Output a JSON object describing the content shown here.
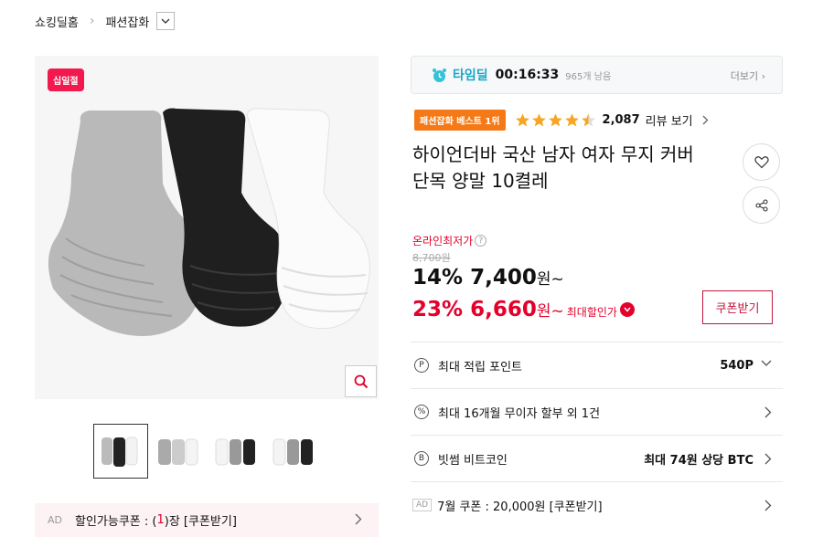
{
  "breadcrumb": {
    "home": "쇼킹딜홈",
    "category": "패션잡화"
  },
  "product_image": {
    "badge": "십일절"
  },
  "ad_coupon_bar": {
    "ad_tag": "AD",
    "label_prefix": "할인가능쿠폰 : (",
    "count": "1",
    "label_suffix": ")장 [쿠폰받기]"
  },
  "timedeal": {
    "label": "타임딜",
    "timer": "00:16:33",
    "remaining": "965개 남음",
    "more": "더보기"
  },
  "rating": {
    "best_badge": "패션잡화 베스트 1위",
    "stars": 4.5,
    "review_count": "2,087",
    "review_label": "리뷰 보기"
  },
  "title_line1": "하이언더바 국산 남자 여자 무지 커버",
  "title_line2": "단목 양말 10켤레",
  "price": {
    "lowest_label": "온라인최저가",
    "original": "8,700원",
    "discount1": "14%",
    "price1": "7,400",
    "won": "원~",
    "discount2": "23%",
    "price2": "6,660",
    "max_label": "최대할인가",
    "coupon_button": "쿠폰받기"
  },
  "benefits": [
    {
      "icon": "P",
      "label": "최대 적립 포인트",
      "value": "540P"
    },
    {
      "icon": "%",
      "label": "최대 16개월 무이자 할부 외 1건",
      "value": ""
    },
    {
      "icon": "B",
      "label": "빗썸 비트코인",
      "value": "최대 74원 상당 BTC"
    },
    {
      "ad_tag": "AD",
      "label": "7월 쿠폰 : 20,000원 [쿠폰받기]",
      "value": ""
    }
  ],
  "colors": {
    "accent_red": "#e4002b",
    "timedeal_blue": "#1aa7c6",
    "best_orange": "#f57a17",
    "star_orange": "#f5a623"
  }
}
